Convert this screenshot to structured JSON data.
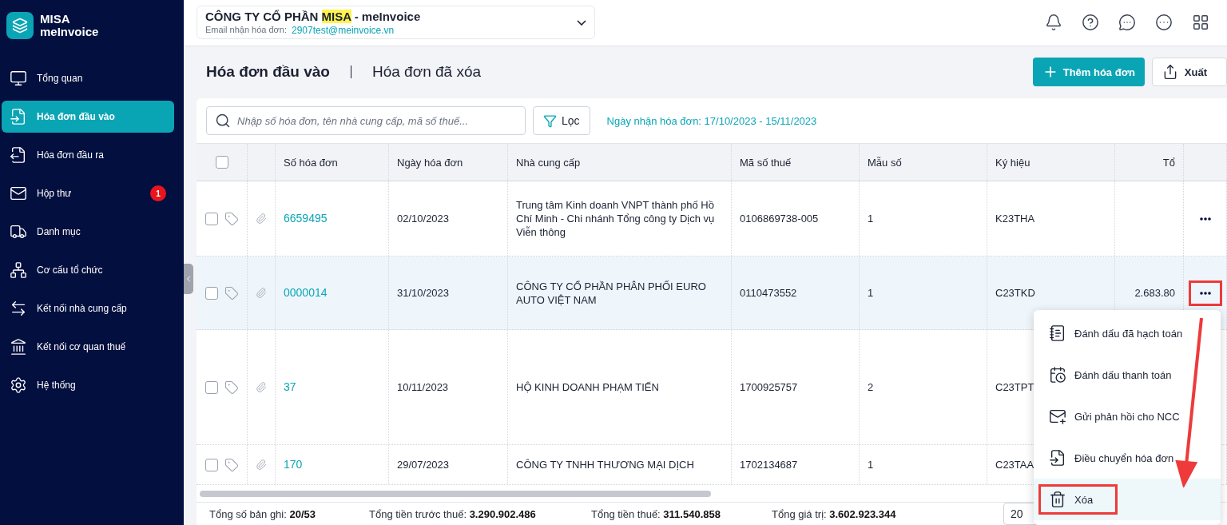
{
  "brand": {
    "line1": "MISA",
    "line2": "meInvoice"
  },
  "sidebar": {
    "items": [
      {
        "label": "Tổng quan",
        "selected": false
      },
      {
        "label": "Hóa đơn đầu vào",
        "selected": true
      },
      {
        "label": "Hóa đơn đầu ra",
        "selected": false
      },
      {
        "label": "Hộp thư",
        "selected": false,
        "badge": "1"
      },
      {
        "label": "Danh mục",
        "selected": false
      },
      {
        "label": "Cơ cấu tổ chức",
        "selected": false
      },
      {
        "label": "Kết nối nhà cung cấp",
        "selected": false
      },
      {
        "label": "Kết nối cơ quan thuế",
        "selected": false
      },
      {
        "label": "Hệ thống",
        "selected": false
      }
    ]
  },
  "company": {
    "name_parts": [
      {
        "text": "CÔNG TY CỔ PHẦN ",
        "highlighted": false
      },
      {
        "text": "MISA",
        "highlighted": true
      },
      {
        "text": " - meInvoice",
        "highlighted": false
      }
    ],
    "email_label": "Email nhận hóa đơn:",
    "email": "2907test@meinvoice.vn"
  },
  "page_tabs": [
    {
      "label": "Hóa đơn đầu vào",
      "selected": true
    },
    {
      "label": "Hóa đơn đã xóa",
      "selected": false
    }
  ],
  "actions": {
    "add": "Thêm hóa đơn",
    "export": "Xuất"
  },
  "toolbar": {
    "search": {
      "placeholder": "Nhập số hóa đơn, tên nhà cung cấp, mã số thuế..."
    },
    "filter": "Lọc",
    "date_range": "Ngày nhận hóa đơn: 17/10/2023 - 15/11/2023"
  },
  "table": {
    "all_checked": false,
    "columns": [
      "Số hóa đơn",
      "Ngày hóa đơn",
      "Nhà cung cấp",
      "Mã số thuế",
      "Mẫu số",
      "Ký hiệu",
      "Tổ"
    ],
    "rows": [
      {
        "checked": false,
        "highlighted": false,
        "annotated": false,
        "number": "6659495",
        "date": "02/10/2023",
        "supplier": "Trung tâm Kinh doanh VNPT thành phố Hồ Chí Minh - Chi nhánh Tổng công ty Dịch vụ Viễn thông",
        "tax_code": "0106869738-005",
        "form": "1",
        "symbol": "K23THA",
        "total": ""
      },
      {
        "checked": false,
        "highlighted": true,
        "annotated": true,
        "number": "0000014",
        "date": "31/10/2023",
        "supplier": "CÔNG TY CỔ PHẦN PHÂN PHỐI EURO AUTO VIỆT NAM",
        "tax_code": "0110473552",
        "form": "1",
        "symbol": "C23TKD",
        "total": "2.683.80"
      },
      {
        "checked": false,
        "highlighted": false,
        "annotated": false,
        "number": "37",
        "date": "10/11/2023",
        "supplier": "HỘ KINH DOANH PHẠM TIẾN",
        "tax_code": "1700925757",
        "form": "2",
        "symbol": "C23TPT",
        "total": ""
      },
      {
        "checked": false,
        "highlighted": false,
        "annotated": false,
        "number": "170",
        "date": "29/07/2023",
        "supplier": "CÔNG TY TNHH THƯƠNG MẠI DỊCH",
        "tax_code": "1702134687",
        "form": "1",
        "symbol": "C23TAA",
        "total": ""
      }
    ]
  },
  "summary": [
    {
      "label": "Tổng số bản ghi:",
      "value": "20/53"
    },
    {
      "label": "Tổng tiền trước thuế:",
      "value": "3.290.902.486"
    },
    {
      "label": "Tổng tiền thuế:",
      "value": "311.540.858"
    },
    {
      "label": "Tổng giá trị:",
      "value": "3.602.923.344"
    }
  ],
  "page_size": "20",
  "context_menu": {
    "items": [
      {
        "label": "Đánh dấu đã hạch toán",
        "highlighted": false,
        "annotated": false
      },
      {
        "label": "Đánh dấu thanh toán",
        "highlighted": false,
        "annotated": false
      },
      {
        "label": "Gửi phản hồi cho NCC",
        "highlighted": false,
        "annotated": false
      },
      {
        "label": "Điều chuyển hóa đơn",
        "highlighted": false,
        "annotated": false
      },
      {
        "label": "Xóa",
        "highlighted": true,
        "annotated": true
      }
    ]
  }
}
